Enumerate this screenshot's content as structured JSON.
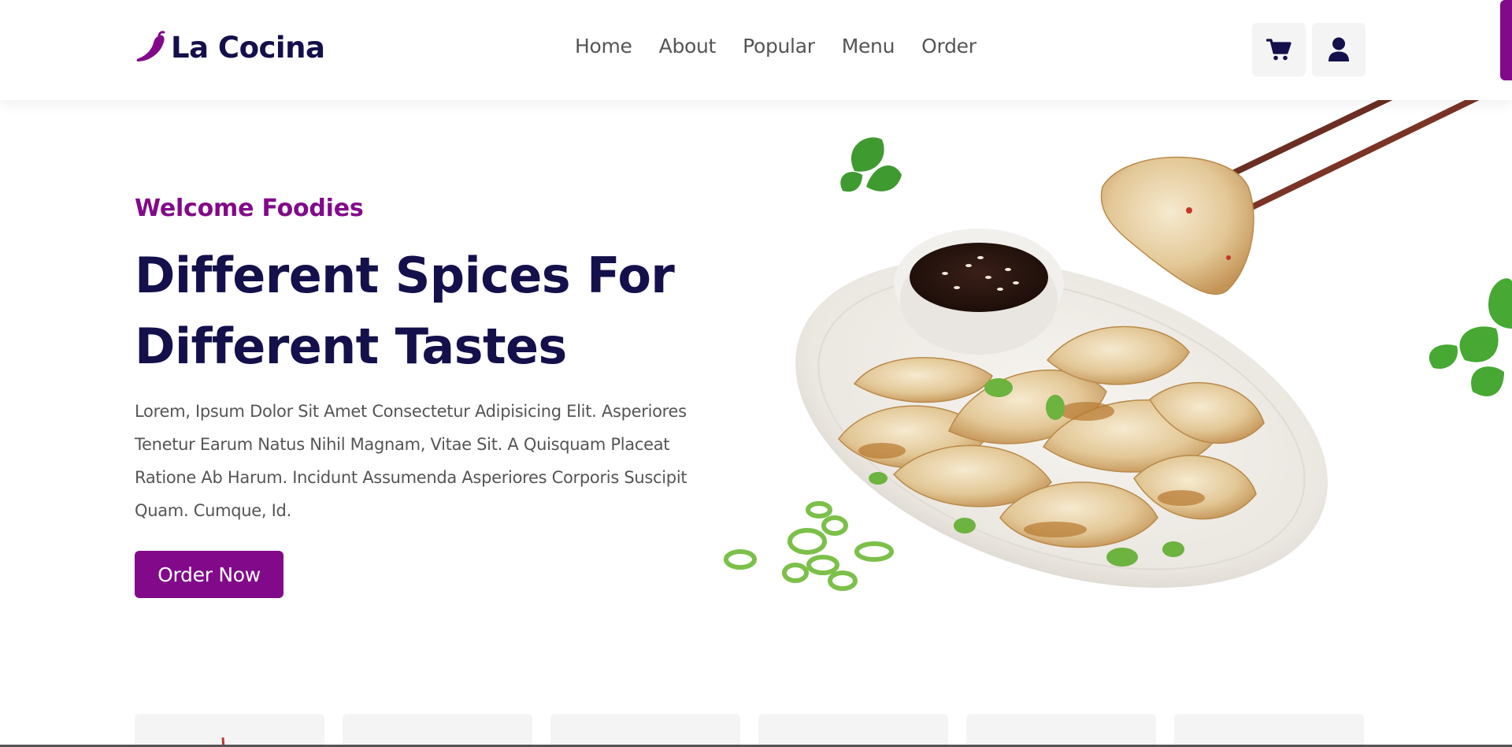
{
  "brand": {
    "name": "La Cocina",
    "icon": "chili-pepper-icon",
    "color": "#820a8a"
  },
  "nav": {
    "items": [
      {
        "label": "Home"
      },
      {
        "label": "About"
      },
      {
        "label": "Popular"
      },
      {
        "label": "Menu"
      },
      {
        "label": "Order"
      }
    ]
  },
  "header_actions": {
    "cart_icon": "cart-icon",
    "user_icon": "user-icon"
  },
  "hero": {
    "subtitle": "Welcome Foodies",
    "title_line1": "Different Spices For",
    "title_line2": "Different Tastes",
    "description": "Lorem, Ipsum Dolor Sit Amet Consectetur Adipisicing Elit. Asperiores Tenetur Earum Natus Nihil Magnam, Vitae Sit. A Quisquam Placeat Ratione Ab Harum. Incidunt Assumenda Asperiores Corporis Suscipit Quam. Cumque, Id.",
    "cta_label": "Order Now",
    "image": "dumplings-plate-with-soy-sauce-and-chopsticks"
  },
  "colors": {
    "primary": "#820a8a",
    "heading": "#13104b",
    "text": "#555555",
    "surface": "#f4f4f4"
  }
}
